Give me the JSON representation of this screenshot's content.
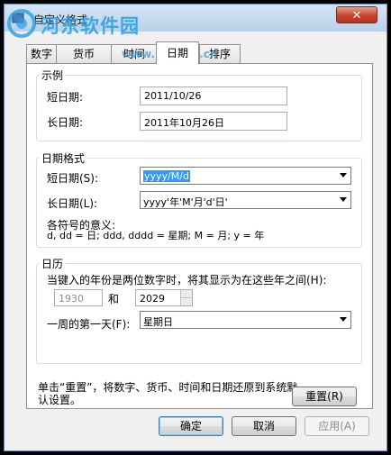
{
  "window": {
    "title": "自定义格式",
    "close_label": "✕"
  },
  "watermark": {
    "text": "河东软件园",
    "url": "www.pc0359.cn"
  },
  "tabs": [
    "数字",
    "货币",
    "时间",
    "日期",
    "排序"
  ],
  "example": {
    "group_label": "示例",
    "short_date_label": "短日期:",
    "short_date_value": "2011/10/26",
    "long_date_label": "长日期:",
    "long_date_value": "2011年10月26日"
  },
  "date_format": {
    "group_label": "日期格式",
    "short_date_label": "短日期(S):",
    "short_date_value": "yyyy/M/d",
    "long_date_label": "长日期(L):",
    "long_date_value": "yyyy'年'M'月'd'日'",
    "legend_title": "各符号的意义:",
    "legend_text": "d, dd = 日;  ddd, dddd = 星期;  M = 月;  y = 年"
  },
  "calendar": {
    "group_label": "日历",
    "two_digit_text": "当键入的年份是两位数字时，将其显示为在这些年之间(H):",
    "year_from": "1930",
    "and_label": "和",
    "year_to": "2029",
    "first_day_label": "一周的第一天(F):",
    "first_day_value": "星期日"
  },
  "footer": {
    "reset_text": "单击“重置”，将数字、货币、时间和日期还原到系统默认设置。",
    "reset_button": "重置(R)"
  },
  "buttons": {
    "ok": "确定",
    "cancel": "取消",
    "apply": "应用(A)"
  },
  "colors": {
    "selection": "#3399ff",
    "close": "#c8412c"
  }
}
